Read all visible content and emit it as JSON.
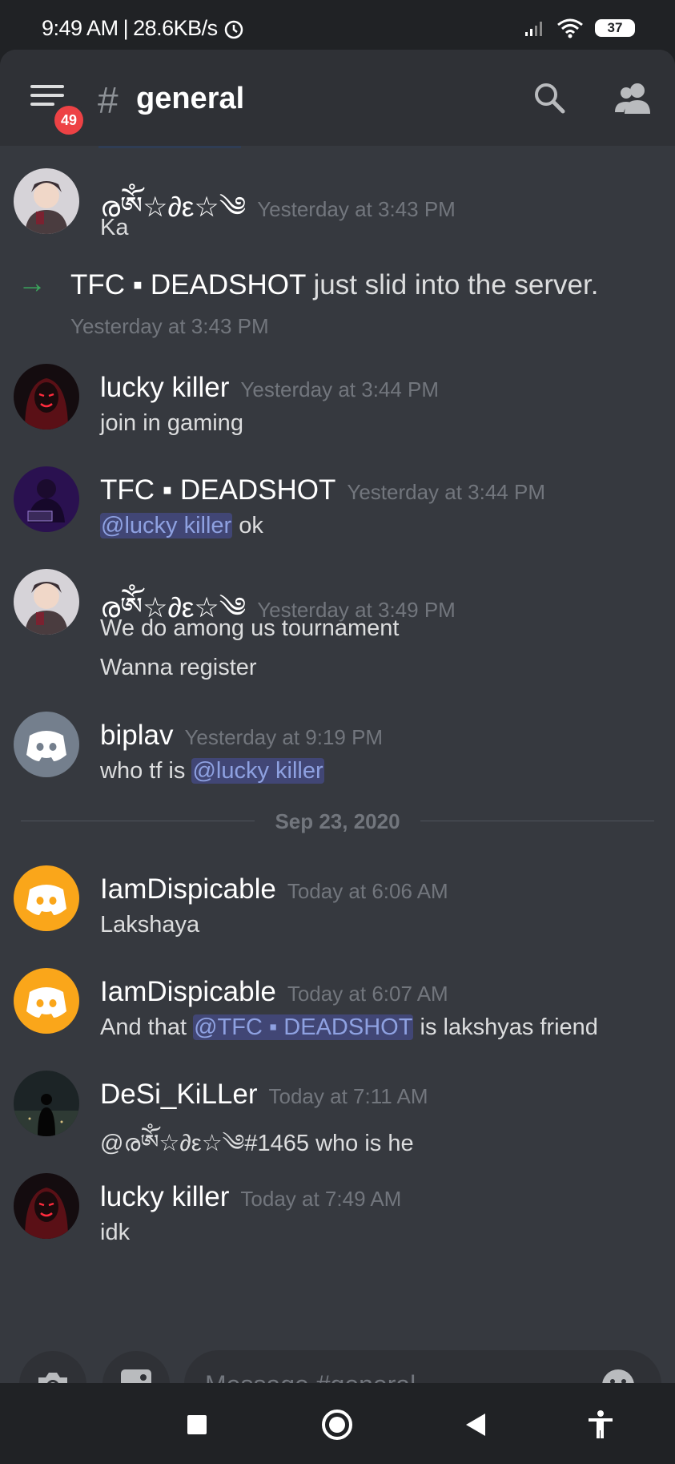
{
  "status_bar": {
    "time": "9:49 AM",
    "speed": "28.6KB/s",
    "battery": "37"
  },
  "header": {
    "hash": "#",
    "channel": "general",
    "unread_badge": "49"
  },
  "messages": [
    {
      "type": "message",
      "author": "രༀ☆∂ε⁣⁣⁣☆༄",
      "time": "Yesterday at 3:43 PM",
      "lines": [
        "Ka"
      ],
      "avatar": "anime"
    },
    {
      "type": "join",
      "name": "TFC ▪ DEADSHOT",
      "text": " just slid into the server.",
      "time": "Yesterday at 3:43 PM"
    },
    {
      "type": "message",
      "author": "lucky killer",
      "time": "Yesterday at 3:44 PM",
      "lines": [
        "join in gaming"
      ],
      "avatar": "red-mask"
    },
    {
      "type": "message",
      "author": "TFC ▪ DEADSHOT",
      "time": "Yesterday at 3:44 PM",
      "mention": "@lucky killer",
      "after": " ok",
      "avatar": "purple"
    },
    {
      "type": "message",
      "author": "രༀ☆∂ε⁣⁣⁣☆༄",
      "time": "Yesterday at 3:49 PM",
      "lines": [
        "We do among us tournament",
        "Wanna register"
      ],
      "avatar": "anime"
    },
    {
      "type": "message",
      "author": "biplav",
      "time": "Yesterday at 9:19 PM",
      "before": "who tf is ",
      "mention": "@lucky killer",
      "avatar": "discord-grey"
    },
    {
      "type": "divider",
      "date": "Sep 23, 2020"
    },
    {
      "type": "message",
      "author": "IamDispicable",
      "time": "Today at 6:06 AM",
      "lines": [
        "Lakshaya"
      ],
      "avatar": "discord-yellow"
    },
    {
      "type": "message",
      "author": "IamDispicable",
      "time": "Today at 6:07 AM",
      "before": "And that ",
      "mention": "@TFC ▪ DEADSHOT",
      "after": " is lakshyas friend",
      "avatar": "discord-yellow"
    },
    {
      "type": "message",
      "author": "DeSi_KiLLer",
      "time": "Today at 7:11 AM",
      "lines": [
        "@രༀ☆∂ε⁣⁣⁣☆༄#1465 who is he"
      ],
      "avatar": "night"
    },
    {
      "type": "message",
      "author": "lucky killer",
      "time": "Today at 7:49 AM",
      "lines": [
        "idk"
      ],
      "avatar": "red-mask"
    }
  ],
  "composer": {
    "placeholder": "Message #general"
  },
  "icons": {
    "menu": "hamburger-menu-icon",
    "search": "search-icon",
    "members": "members-icon",
    "camera": "camera-icon",
    "gallery": "image-icon",
    "emoji": "emoji-icon",
    "join": "arrow-right-icon"
  },
  "colors": {
    "background": "#36393f",
    "header": "#2f3136",
    "mention_bg": "#414675",
    "mention_text": "#8ea1e1",
    "join_arrow": "#3ba55c",
    "badge": "#ed4245",
    "discord_yellow": "#faa61a",
    "discord_grey": "#747f8d"
  }
}
